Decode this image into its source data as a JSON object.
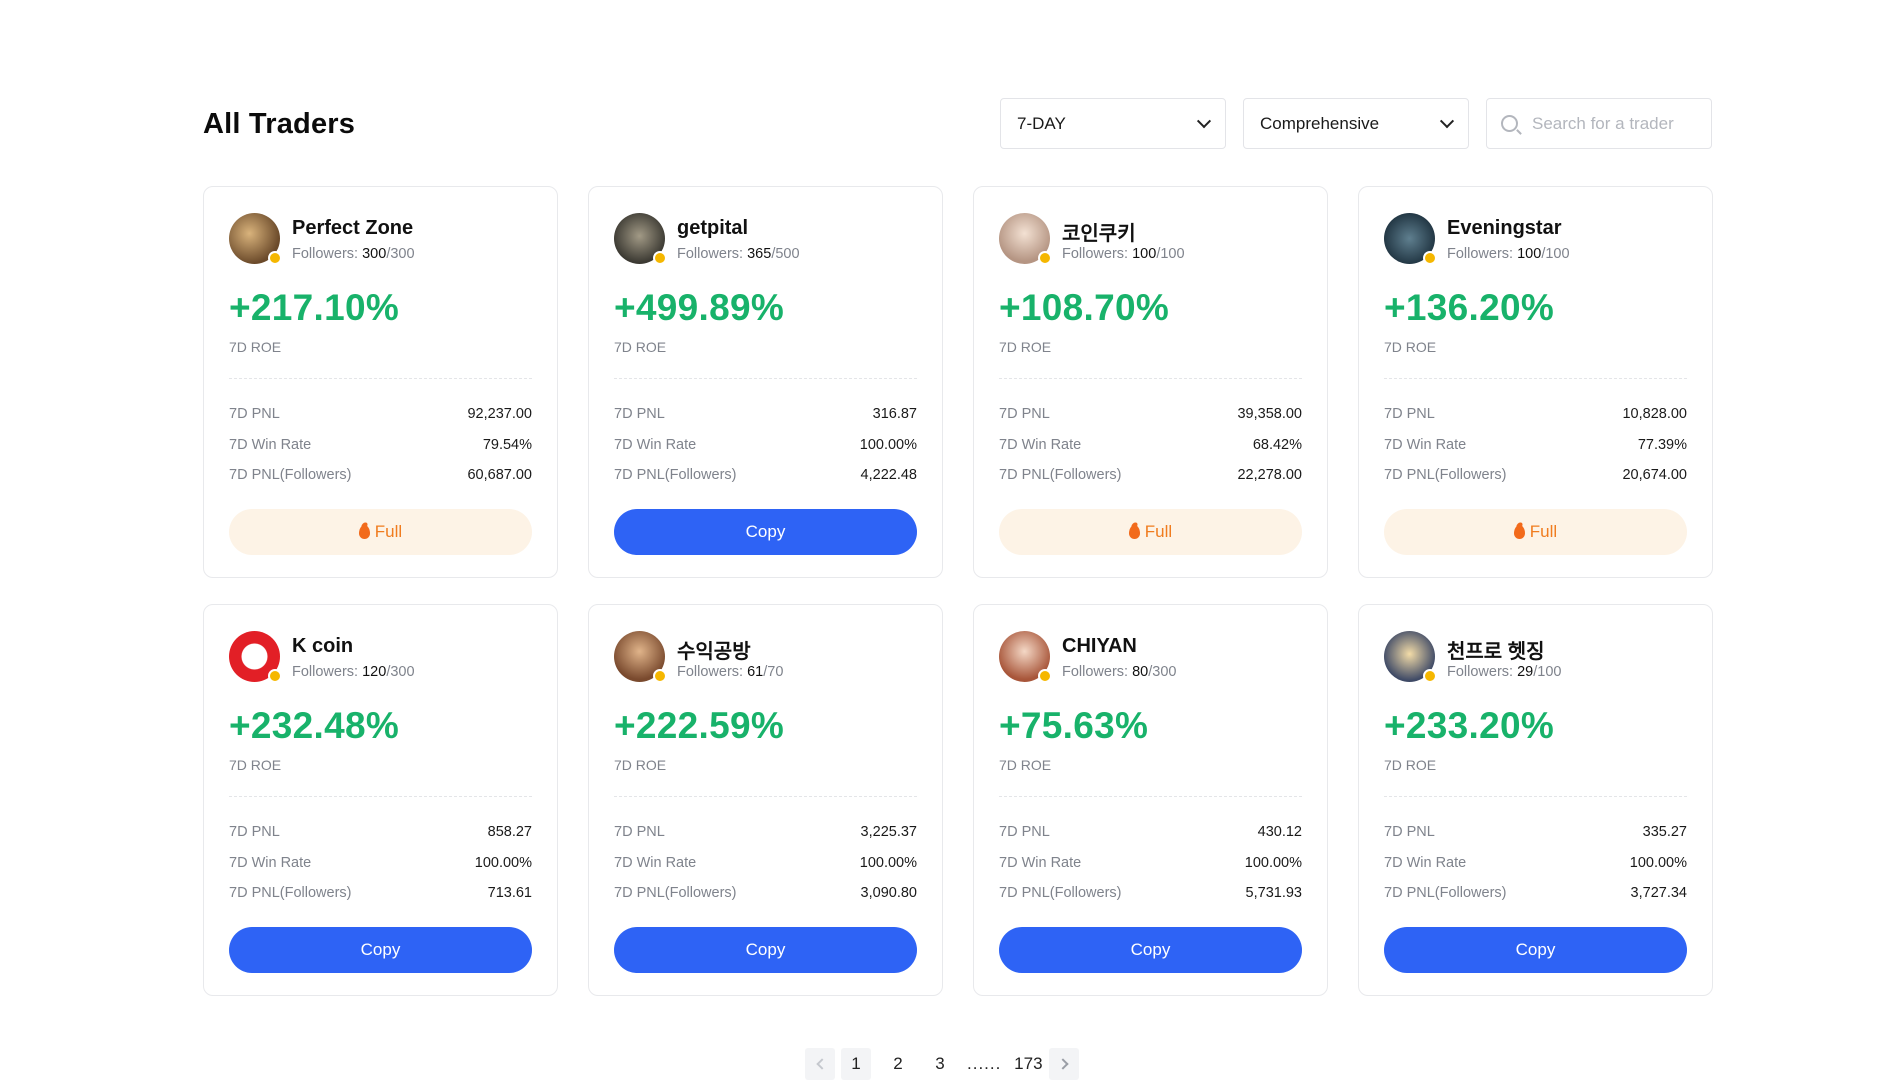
{
  "page": {
    "title": "All Traders"
  },
  "filters": {
    "period": "7-DAY",
    "sort": "Comprehensive",
    "search_placeholder": "Search for a trader"
  },
  "labels": {
    "roe": "7D ROE",
    "pnl": "7D PNL",
    "win_rate": "7D Win Rate",
    "pnl_followers": "7D PNL(Followers)",
    "followers": "Followers: "
  },
  "colors": {
    "positive": "#18b26a",
    "copy_button": "#2e63f5",
    "full_button_bg": "#fdf3e6",
    "full_button_text": "#f07c1f"
  },
  "traders": [
    {
      "name": "Perfect Zone",
      "followers": "300",
      "max": "/300",
      "roe": "+217.10%",
      "pnl": "92,237.00",
      "win_rate": "79.54%",
      "pnl_followers": "60,687.00",
      "button": "Full",
      "status": "full"
    },
    {
      "name": "getpital",
      "followers": "365",
      "max": "/500",
      "roe": "+499.89%",
      "pnl": "316.87",
      "win_rate": "100.00%",
      "pnl_followers": "4,222.48",
      "button": "Copy",
      "status": "copy"
    },
    {
      "name": "코인쿠키",
      "followers": "100",
      "max": "/100",
      "roe": "+108.70%",
      "pnl": "39,358.00",
      "win_rate": "68.42%",
      "pnl_followers": "22,278.00",
      "button": "Full",
      "status": "full"
    },
    {
      "name": "Eveningstar",
      "followers": "100",
      "max": "/100",
      "roe": "+136.20%",
      "pnl": "10,828.00",
      "win_rate": "77.39%",
      "pnl_followers": "20,674.00",
      "button": "Full",
      "status": "full"
    },
    {
      "name": "K coin",
      "followers": "120",
      "max": "/300",
      "roe": "+232.48%",
      "pnl": "858.27",
      "win_rate": "100.00%",
      "pnl_followers": "713.61",
      "button": "Copy",
      "status": "copy"
    },
    {
      "name": "수익공방",
      "followers": "61",
      "max": "/70",
      "roe": "+222.59%",
      "pnl": "3,225.37",
      "win_rate": "100.00%",
      "pnl_followers": "3,090.80",
      "button": "Copy",
      "status": "copy"
    },
    {
      "name": "CHIYAN",
      "followers": "80",
      "max": "/300",
      "roe": "+75.63%",
      "pnl": "430.12",
      "win_rate": "100.00%",
      "pnl_followers": "5,731.93",
      "button": "Copy",
      "status": "copy"
    },
    {
      "name": "천프로 헷징",
      "followers": "29",
      "max": "/100",
      "roe": "+233.20%",
      "pnl": "335.27",
      "win_rate": "100.00%",
      "pnl_followers": "3,727.34",
      "button": "Copy",
      "status": "copy"
    }
  ],
  "pagination": {
    "pages": [
      "1",
      "2",
      "3"
    ],
    "ellipsis": "......",
    "last": "173",
    "current": "1"
  }
}
